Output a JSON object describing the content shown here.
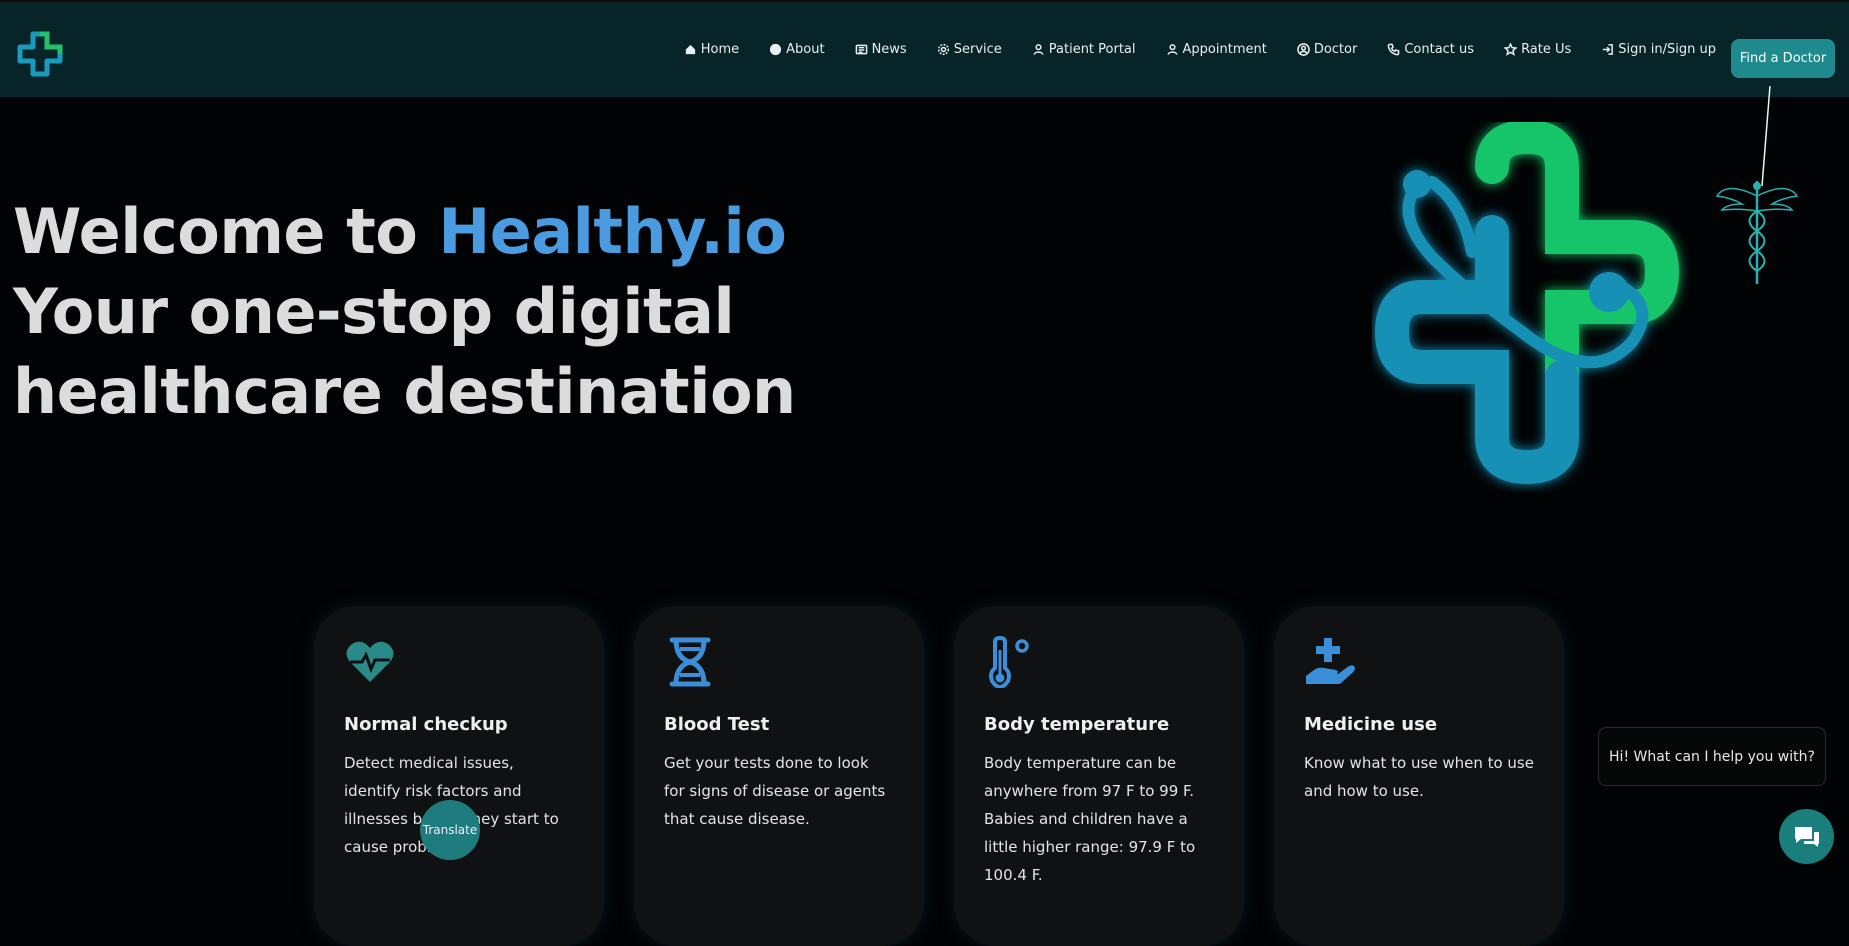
{
  "nav": {
    "items": [
      {
        "label": "Home",
        "icon": "home-icon"
      },
      {
        "label": "About",
        "icon": "info-icon"
      },
      {
        "label": "News",
        "icon": "newspaper-icon"
      },
      {
        "label": "Service",
        "icon": "gear-icon"
      },
      {
        "label": "Patient Portal",
        "icon": "user-icon"
      },
      {
        "label": "Appointment",
        "icon": "user-icon"
      },
      {
        "label": "Doctor",
        "icon": "user-circle-icon"
      },
      {
        "label": "Contact us",
        "icon": "phone-icon"
      },
      {
        "label": "Rate Us",
        "icon": "star-icon"
      },
      {
        "label": "Sign in/Sign up",
        "icon": "sign-in-icon"
      }
    ],
    "cta": "Find a Doctor"
  },
  "hero": {
    "welcome": "Welcome to ",
    "brand": "Healthy.io",
    "line2": "Your one-stop digital",
    "line3": "healthcare destination"
  },
  "cards": [
    {
      "title": "Normal checkup",
      "text": "Detect medical issues, identify risk factors and illnesses before they start to cause problems.",
      "icon": "heartbeat-icon"
    },
    {
      "title": "Blood Test",
      "text": "Get your tests done to look for signs of disease or agents that cause disease.",
      "icon": "dna-icon"
    },
    {
      "title": "Body temperature",
      "text": "Body temperature can be anywhere from 97 F to 99 F. Babies and children have a little higher range: 97.9 F to 100.4 F.",
      "icon": "thermometer-icon"
    },
    {
      "title": "Medicine use",
      "text": "Know what to use when to use and how to use.",
      "icon": "hand-medical-icon"
    }
  ],
  "translate": "Translate",
  "chat": {
    "prompt": "Hi! What can I help you with?",
    "icon": "chat-icon"
  },
  "colors": {
    "navbar": "#072528",
    "accent": "#1f8a8e",
    "brand_text": "#4a9be0",
    "icon_teal": "#2a8a88",
    "icon_blue": "#3b8fd9"
  }
}
